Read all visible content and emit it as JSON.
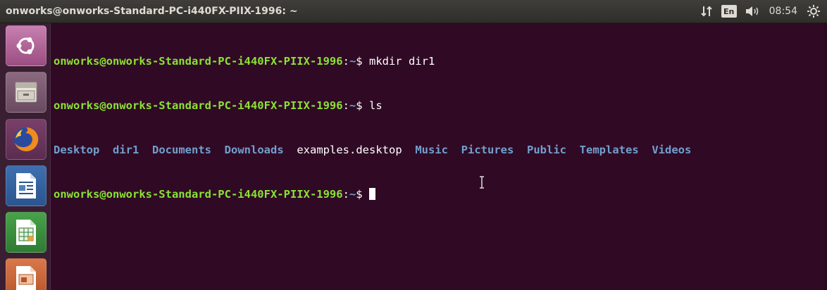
{
  "topbar": {
    "title": "onworks@onworks-Standard-PC-i440FX-PIIX-1996: ~",
    "keyboard_layout": "En",
    "clock": "08:54",
    "icons": [
      "network-icon",
      "volume-icon",
      "gear-icon"
    ]
  },
  "launcher": {
    "items": [
      {
        "name": "dash-icon"
      },
      {
        "name": "files-icon"
      },
      {
        "name": "firefox-icon"
      },
      {
        "name": "libreoffice-writer-icon"
      },
      {
        "name": "libreoffice-calc-icon"
      },
      {
        "name": "libreoffice-impress-icon"
      }
    ]
  },
  "terminal": {
    "prompt_user": "onworks@onworks-Standard-PC-i440FX-PIIX-1996",
    "prompt_path": "~",
    "prompt_symbol": "$",
    "commands": [
      "mkdir dir1",
      "ls"
    ],
    "ls_output": [
      {
        "name": "Desktop",
        "type": "dir"
      },
      {
        "name": "dir1",
        "type": "dir"
      },
      {
        "name": "Documents",
        "type": "dir"
      },
      {
        "name": "Downloads",
        "type": "dir"
      },
      {
        "name": "examples.desktop",
        "type": "file"
      },
      {
        "name": "Music",
        "type": "dir"
      },
      {
        "name": "Pictures",
        "type": "dir"
      },
      {
        "name": "Public",
        "type": "dir"
      },
      {
        "name": "Templates",
        "type": "dir"
      },
      {
        "name": "Videos",
        "type": "dir"
      }
    ],
    "colors": {
      "background": "#300a24",
      "user": "#8ae234",
      "path": "#729fcf",
      "directory": "#729fcf",
      "text": "#ffffff"
    }
  }
}
